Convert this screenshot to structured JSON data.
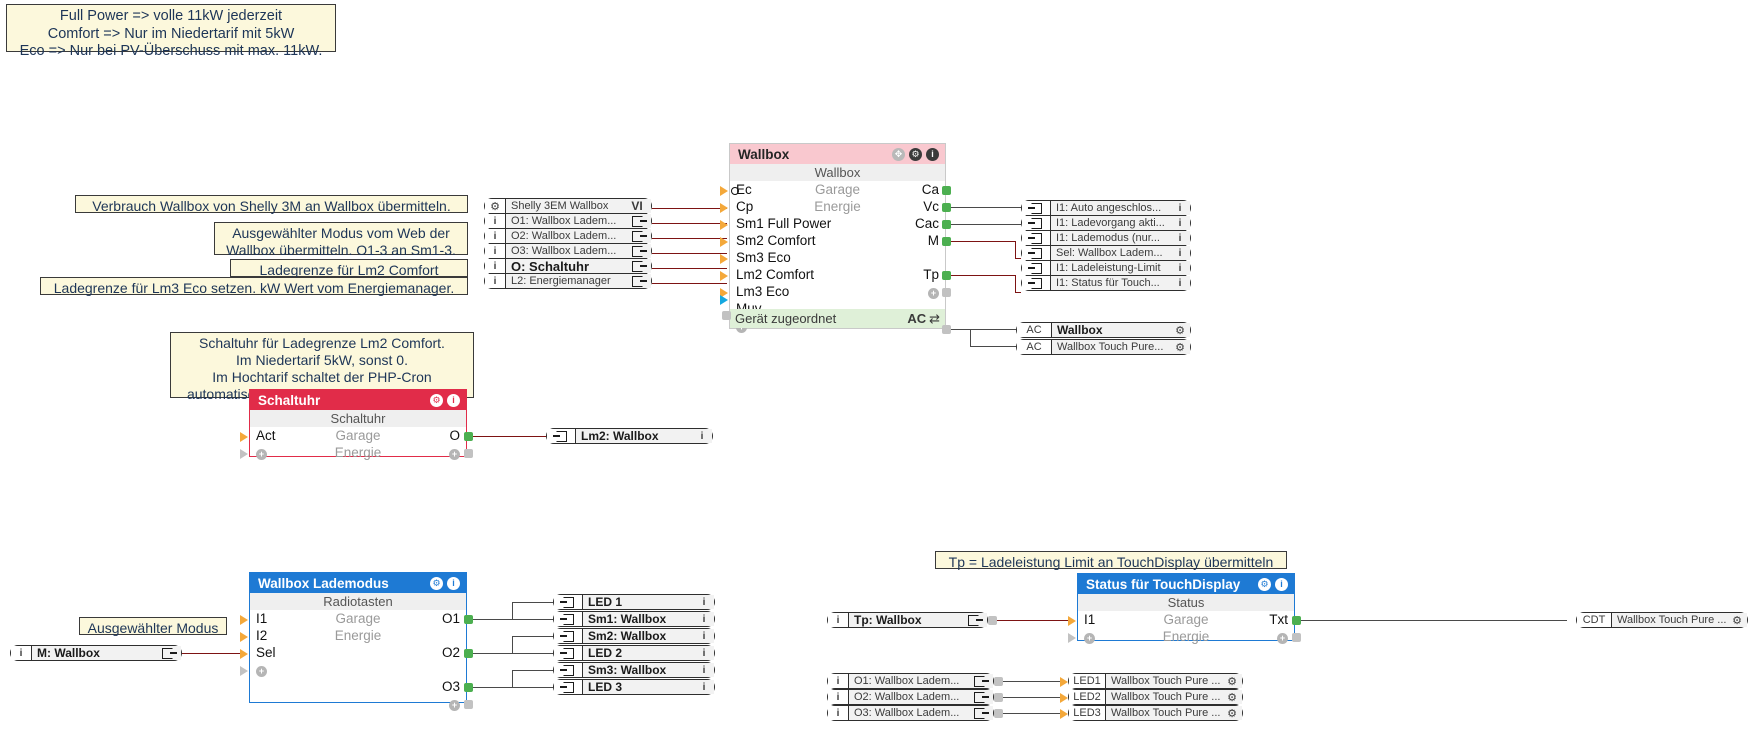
{
  "notes": [
    {
      "id": "note-modes",
      "text": "Full Power => volle 11kW jederzeit\nComfort => Nur im Niedertarif mit 5kW\nEco => Nur bei PV-Überschuss mit max. 11kW."
    },
    {
      "id": "note-verbrauch",
      "text": "Verbrauch Wallbox von Shelly 3M an Wallbox übermitteln."
    },
    {
      "id": "note-modus",
      "text": "Ausgewählter Modus vom Web der\nWallbox übermitteln. O1-3 an Sm1-3."
    },
    {
      "id": "note-lm2",
      "text": "Ladegrenze für Lm2 Comfort setzen."
    },
    {
      "id": "note-lm3",
      "text": "Ladegrenze für Lm3 Eco setzen. kW Wert vom Energiemanager."
    },
    {
      "id": "note-schaltuhr",
      "text": "Schaltuhr für Ladegrenze Lm2 Comfort.\nIm Niedertarif 5kW, sonst 0.\nIm Hochtarif schaltet der PHP-Cron\nautomatisch auf Eco und am Abend zurück."
    },
    {
      "id": "note-modus-sel",
      "text": "Ausgewählter Modus"
    },
    {
      "id": "note-tp",
      "text": "Tp = Ladeleistung Limit an TouchDisplay übermitteln"
    }
  ],
  "modules": {
    "wallbox": {
      "title": "Wallbox",
      "subtitle": "Wallbox",
      "mid": [
        "Garage",
        "Energie"
      ],
      "inputs": [
        "Ec",
        "Cp",
        "Sm1 Full Power",
        "Sm2 Comfort",
        "Sm3 Eco",
        "Lm2 Comfort",
        "Lm3 Eco",
        "Muv"
      ],
      "outputs": [
        "Ca",
        "Vc",
        "Cac",
        "M",
        "",
        "Tp"
      ],
      "footer": "Gerät zugeordnet",
      "footer_right": "AC",
      "icons": {
        "move": "move-icon",
        "gear": "gear-icon",
        "info": "info-icon"
      }
    },
    "schaltuhr": {
      "title": "Schaltuhr",
      "subtitle": "Schaltuhr",
      "mid": [
        "Garage",
        "Energie"
      ],
      "inputs": [
        "Act"
      ],
      "outputs": [
        "O"
      ],
      "icons": {
        "gear": "gear-icon",
        "info": "info-icon"
      }
    },
    "lademodus": {
      "title": "Wallbox Lademodus",
      "subtitle": "Radiotasten",
      "mid": [
        "Garage",
        "Energie"
      ],
      "inputs": [
        "I1",
        "I2",
        "Sel"
      ],
      "outputs": [
        "O1",
        "O2",
        "O3"
      ],
      "icons": {
        "gear": "gear-icon",
        "info": "info-icon"
      }
    },
    "status": {
      "title": "Status für TouchDisplay",
      "subtitle": "Status",
      "mid": [
        "Garage",
        "Energie"
      ],
      "inputs": [
        "I1"
      ],
      "outputs": [
        "Txt"
      ],
      "icons": {
        "gear": "gear-icon",
        "info": "info-icon"
      }
    }
  },
  "chips": {
    "wallbox_in": [
      {
        "icon": "gear-icon",
        "label": "Shelly 3EM Wallbox",
        "right": "VI",
        "bold": false
      },
      {
        "icon": "info-icon",
        "label": "O1: Wallbox Ladem...",
        "right": "out-glyph",
        "bold": false
      },
      {
        "icon": "info-icon",
        "label": "O2: Wallbox Ladem...",
        "right": "out-glyph",
        "bold": false
      },
      {
        "icon": "info-icon",
        "label": "O3: Wallbox Ladem...",
        "right": "out-glyph",
        "bold": false
      },
      {
        "icon": "info-icon",
        "label": "O: Schaltuhr",
        "right": "out-glyph",
        "bold": true
      },
      {
        "icon": "info-icon",
        "label": "L2: Energiemanager",
        "right": "out-glyph",
        "bold": false
      }
    ],
    "wallbox_out": [
      {
        "icon": "in-glyph",
        "label": "I1: Auto angeschlos...",
        "right": "info-icon"
      },
      {
        "icon": "in-glyph",
        "label": "I1: Ladevorgang akti...",
        "right": "info-icon"
      },
      {
        "icon": "in-glyph",
        "label": "I1: Lademodus (nur...",
        "right": "info-icon"
      },
      {
        "icon": "in-glyph",
        "label": "Sel: Wallbox Ladem...",
        "right": "info-icon"
      },
      {
        "icon": "in-glyph",
        "label": "I1: Ladeleistung-Limit",
        "right": "info-icon"
      },
      {
        "icon": "in-glyph",
        "label": "I1: Status für Touch...",
        "right": "info-icon"
      }
    ],
    "wallbox_dev": [
      {
        "icon": "AC",
        "label": "Wallbox",
        "right": "gear-icon",
        "bold": true
      },
      {
        "icon": "AC",
        "label": "Wallbox Touch Pure...",
        "right": "gear-icon",
        "bold": false
      }
    ],
    "schaltuhr_out": [
      {
        "icon": "in-glyph",
        "label": "Lm2: Wallbox",
        "right": "info-icon",
        "bold": true
      }
    ],
    "lademodus_out": [
      {
        "icon": "in-glyph",
        "label": "LED 1",
        "right": "info-icon",
        "bold": true
      },
      {
        "icon": "in-glyph",
        "label": "Sm1: Wallbox",
        "right": "info-icon",
        "bold": true
      },
      {
        "icon": "in-glyph",
        "label": "Sm2: Wallbox",
        "right": "info-icon",
        "bold": true
      },
      {
        "icon": "in-glyph",
        "label": "LED 2",
        "right": "info-icon",
        "bold": true
      },
      {
        "icon": "in-glyph",
        "label": "Sm3: Wallbox",
        "right": "info-icon",
        "bold": true
      },
      {
        "icon": "in-glyph",
        "label": "LED 3",
        "right": "info-icon",
        "bold": true
      }
    ],
    "lademodus_in": [
      {
        "icon": "info-icon",
        "label": "M: Wallbox",
        "right": "out-glyph",
        "bold": true
      }
    ],
    "status_in": [
      {
        "icon": "info-icon",
        "label": "Tp: Wallbox",
        "right": "out-glyph",
        "bold": true
      }
    ],
    "status_out": [
      {
        "icon": "CDT",
        "label": "Wallbox Touch Pure ...",
        "right": "gear-icon",
        "bold": false
      }
    ],
    "led_sources": [
      {
        "icon": "info-icon",
        "label": "O1: Wallbox Ladem...",
        "right": "out-glyph"
      },
      {
        "icon": "info-icon",
        "label": "O2: Wallbox Ladem...",
        "right": "out-glyph"
      },
      {
        "icon": "info-icon",
        "label": "O3: Wallbox Ladem...",
        "right": "out-glyph"
      }
    ],
    "led_targets": [
      {
        "icon": "LED1",
        "label": "Wallbox Touch Pure ...",
        "right": "gear-icon"
      },
      {
        "icon": "LED2",
        "label": "Wallbox Touch Pure ...",
        "right": "gear-icon"
      },
      {
        "icon": "LED3",
        "label": "Wallbox Touch Pure ...",
        "right": "gear-icon"
      }
    ]
  },
  "colors": {
    "wire_red": "#7d1313",
    "wire_grey": "#4a4a4a",
    "accent_red": "#e12c49",
    "accent_blue": "#1e7ad4",
    "pin_green": "#4caf50",
    "pin_orange": "#f4a83a",
    "note_bg": "#fcf8dc"
  }
}
